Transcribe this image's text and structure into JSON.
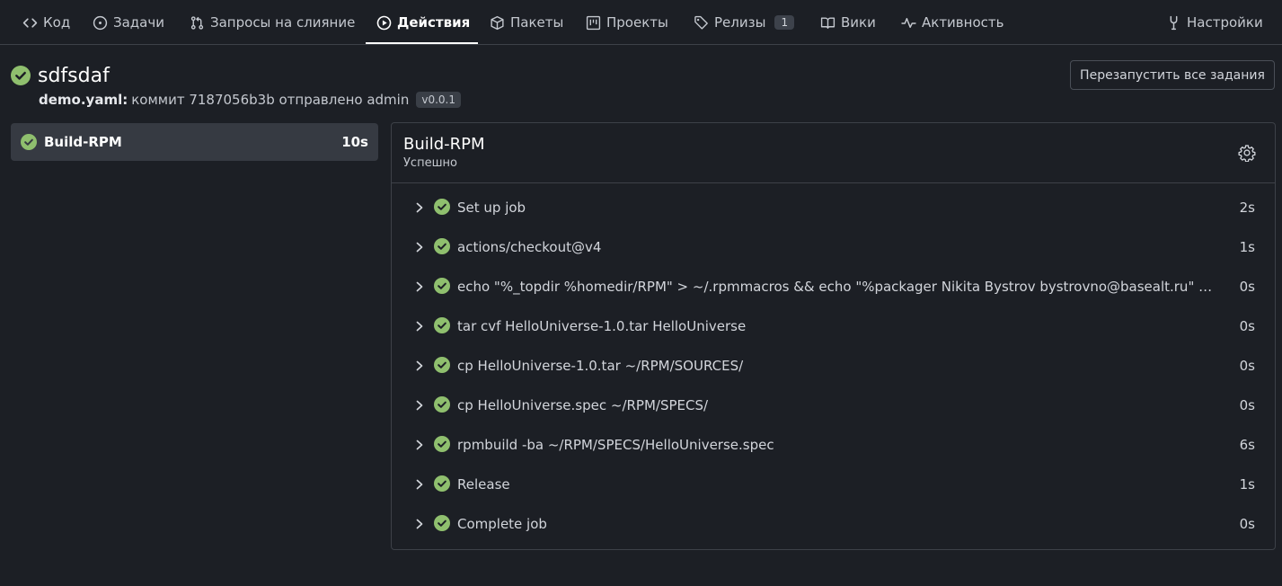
{
  "nav": {
    "code": "Код",
    "issues": "Задачи",
    "pulls": "Запросы на слияние",
    "actions": "Действия",
    "packages": "Пакеты",
    "projects": "Проекты",
    "releases": "Релизы",
    "releases_count": "1",
    "wiki": "Вики",
    "activity": "Активность",
    "settings": "Настройки"
  },
  "run": {
    "title": "sdfsdaf",
    "workflow": "demo.yaml:",
    "commit_text": "коммит 7187056b3b отправлено admin",
    "tag": "v0.0.1",
    "rerun_label": "Перезапустить все задания"
  },
  "jobs": [
    {
      "name": "Build-RPM",
      "duration": "10s",
      "status": "success"
    }
  ],
  "job_panel": {
    "title": "Build-RPM",
    "status": "Успешно",
    "steps": [
      {
        "label": "Set up job",
        "duration": "2s"
      },
      {
        "label": "actions/checkout@v4",
        "duration": "1s"
      },
      {
        "label": "echo \"%_topdir %homedir/RPM\" > ~/.rpmmacros && echo \"%packager Nikita Bystrov bystrovno@basealt.ru\" >> ~/.rpmmacros",
        "duration": "0s"
      },
      {
        "label": "tar cvf HelloUniverse-1.0.tar HelloUniverse",
        "duration": "0s"
      },
      {
        "label": "cp HelloUniverse-1.0.tar ~/RPM/SOURCES/",
        "duration": "0s"
      },
      {
        "label": "cp HelloUniverse.spec ~/RPM/SPECS/",
        "duration": "0s"
      },
      {
        "label": "rpmbuild -ba ~/RPM/SPECS/HelloUniverse.spec",
        "duration": "6s"
      },
      {
        "label": "Release",
        "duration": "1s"
      },
      {
        "label": "Complete job",
        "duration": "0s"
      }
    ]
  },
  "colors": {
    "background": "#1c1f25",
    "success": "#8fbf6e",
    "border": "#3d4148",
    "selected_job_bg": "#363a42"
  }
}
